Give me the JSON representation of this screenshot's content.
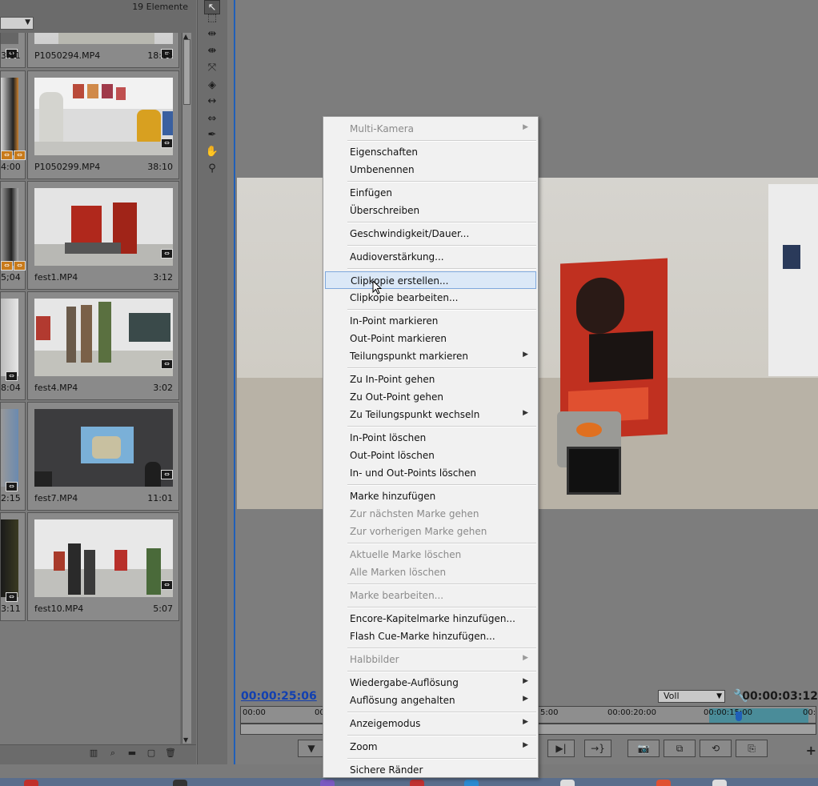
{
  "project_panel": {
    "item_count": "19 Elemente",
    "clips": [
      {
        "left_duration": "3:11",
        "name": "P1050294.MP4",
        "duration": "18:18"
      },
      {
        "left_duration": "4:00",
        "name": "P1050299.MP4",
        "duration": "38:10"
      },
      {
        "left_duration": "5;04",
        "name": "fest1.MP4",
        "duration": "3:12"
      },
      {
        "left_duration": "8:04",
        "name": "fest4.MP4",
        "duration": "3:02"
      },
      {
        "left_duration": "2:15",
        "name": "fest7.MP4",
        "duration": "11:01"
      },
      {
        "left_duration": "3:11",
        "name": "fest10.MP4",
        "duration": "5:07"
      }
    ],
    "footer_icons": [
      "list-view-icon",
      "search-icon",
      "folder-icon",
      "new-item-icon",
      "trash-icon"
    ]
  },
  "tools": [
    "selection-tool-icon",
    "track-select-tool-icon",
    "ripple-edit-tool-icon",
    "rolling-edit-tool-icon",
    "rate-stretch-tool-icon",
    "razor-tool-icon",
    "slip-tool-icon",
    "slide-tool-icon",
    "pen-tool-icon",
    "hand-tool-icon",
    "zoom-tool-icon"
  ],
  "monitor": {
    "current_timecode": "00:00:25:06",
    "duration_timecode": "00:00:03:12",
    "zoom_level": "Voll",
    "ruler_labels": [
      "00:00",
      "00",
      "5:00",
      "00:00:20:00",
      "00:00:15:00",
      "00:"
    ],
    "add_button": "+"
  },
  "context_menu": {
    "items": [
      {
        "label": "Multi-Kamera",
        "disabled": true,
        "submenu": true
      },
      {
        "label": "Eigenschaften"
      },
      {
        "label": "Umbenennen"
      },
      {
        "label": "Einfügen"
      },
      {
        "label": "Überschreiben"
      },
      {
        "label": "Geschwindigkeit/Dauer..."
      },
      {
        "label": "Audioverstärkung..."
      },
      {
        "label": "Clipkopie erstellen...",
        "highlighted": true
      },
      {
        "label": "Clipkopie bearbeiten..."
      },
      {
        "label": "In-Point markieren"
      },
      {
        "label": "Out-Point markieren"
      },
      {
        "label": "Teilungspunkt markieren",
        "submenu": true
      },
      {
        "label": "Zu In-Point gehen"
      },
      {
        "label": "Zu Out-Point gehen"
      },
      {
        "label": "Zu Teilungspunkt wechseln",
        "submenu": true
      },
      {
        "label": "In-Point löschen"
      },
      {
        "label": "Out-Point löschen"
      },
      {
        "label": "In- und Out-Points löschen"
      },
      {
        "label": "Marke hinzufügen"
      },
      {
        "label": "Zur nächsten Marke gehen",
        "disabled": true
      },
      {
        "label": "Zur vorherigen Marke gehen",
        "disabled": true
      },
      {
        "label": "Aktuelle Marke löschen",
        "disabled": true
      },
      {
        "label": "Alle Marken löschen",
        "disabled": true
      },
      {
        "label": "Marke bearbeiten...",
        "disabled": true
      },
      {
        "label": "Encore-Kapitelmarke hinzufügen..."
      },
      {
        "label": "Flash Cue-Marke hinzufügen..."
      },
      {
        "label": "Halbbilder",
        "disabled": true,
        "submenu": true
      },
      {
        "label": "Wiedergabe-Auflösung",
        "submenu": true
      },
      {
        "label": "Auflösung angehalten",
        "submenu": true
      },
      {
        "label": "Anzeigemodus",
        "submenu": true
      },
      {
        "label": "Zoom",
        "submenu": true
      },
      {
        "label": "Sichere Ränder"
      }
    ]
  },
  "colors": {
    "menu_background": "#f1f1f1",
    "menu_highlight": "#dbe8f7",
    "panel_gray": "#7a7a7a",
    "active_border": "#1f5fb8",
    "timecode_blue": "#1240b0"
  }
}
